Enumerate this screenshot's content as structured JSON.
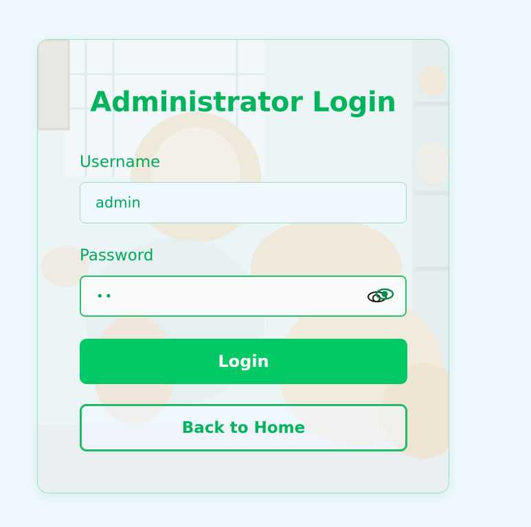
{
  "login_card": {
    "title": "Administrator Login",
    "username": {
      "label": "Username",
      "value": "admin"
    },
    "password": {
      "label": "Password",
      "value": "••",
      "toggle_icon": "eye-icon"
    },
    "login_button_label": "Login",
    "back_button_label": "Back to Home"
  },
  "colors": {
    "accent": "#00c864",
    "title_green": "#00b35c",
    "page_background": "#f0f8ff"
  }
}
